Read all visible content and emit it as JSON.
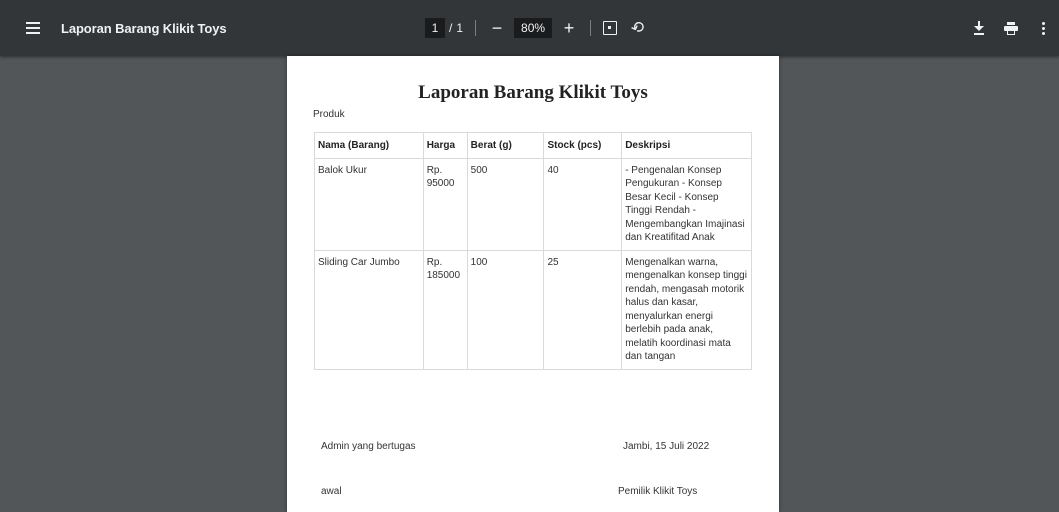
{
  "toolbar": {
    "title": "Laporan Barang Klikit Toys",
    "page_current": "1",
    "page_separator": "/",
    "page_total": "1",
    "zoom": "80%",
    "zoom_out_label": "−",
    "zoom_in_label": "+",
    "icons": [
      "menu-icon",
      "fit-page-icon",
      "rotate-icon",
      "download-icon",
      "print-icon",
      "more-icon"
    ]
  },
  "document": {
    "title": "Laporan Barang Klikit Toys",
    "section_label": "Produk",
    "table": {
      "headers": [
        "Nama (Barang)",
        "Harga",
        "Berat (g)",
        "Stock (pcs)",
        "Deskripsi"
      ],
      "rows": [
        [
          "Balok Ukur",
          "Rp. 95000",
          "500",
          "40",
          "- Pengenalan Konsep Pengukuran - Konsep Besar Kecil - Konsep Tinggi Rendah - Mengembangkan Imajinasi dan Kreatifitad Anak"
        ],
        [
          "Sliding Car Jumbo",
          "Rp. 185000",
          "100",
          "25",
          "Mengenalkan warna, mengenalkan konsep tinggi rendah, mengasah motorik halus dan kasar, menyalurkan energi berlebih pada anak, melatih koordinasi mata dan tangan"
        ]
      ]
    },
    "signature": {
      "left_title": "Admin yang bertugas",
      "right_title": "Jambi, 15 Juli 2022",
      "left_name": "awal",
      "right_name": "Pemilik Klikit Toys"
    }
  }
}
